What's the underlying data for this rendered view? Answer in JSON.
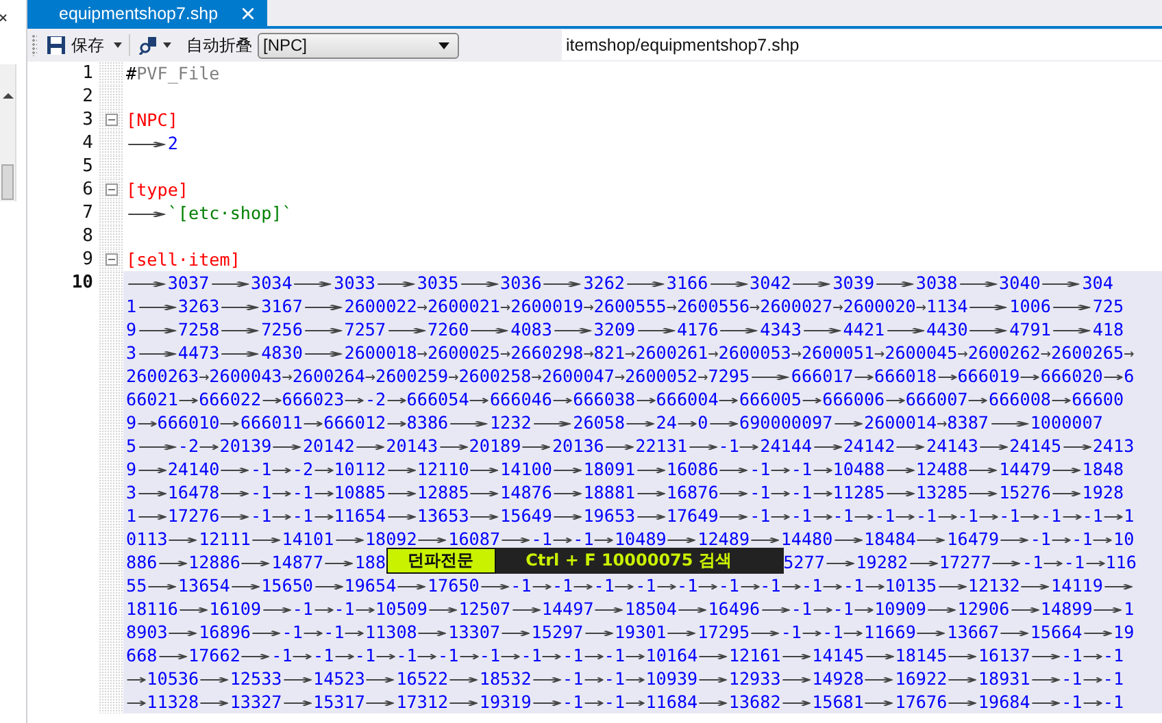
{
  "tab": {
    "title": "equipmentshop7.shp",
    "selected": true
  },
  "toolbar": {
    "save_label": "保存",
    "fold_label": "自动折叠",
    "section_select": "[NPC]",
    "path": "itemshop/equipmentshop7.shp"
  },
  "lines": [
    {
      "number": "1",
      "fold": false,
      "current": false,
      "segments": [
        {
          "kind": "plain",
          "text": "#"
        },
        {
          "kind": "comment",
          "text": "PVF_File"
        }
      ]
    },
    {
      "number": "2",
      "fold": false,
      "current": false
    },
    {
      "number": "3",
      "fold": true,
      "current": false,
      "segments": [
        {
          "kind": "section",
          "text": "[NPC]"
        }
      ]
    },
    {
      "number": "4",
      "fold": false,
      "current": false,
      "segments": [
        {
          "kind": "tab",
          "text": "→"
        },
        {
          "kind": "number",
          "text": "2"
        }
      ]
    },
    {
      "number": "5",
      "fold": false,
      "current": false
    },
    {
      "number": "6",
      "fold": true,
      "current": false,
      "segments": [
        {
          "kind": "section",
          "text": "[type]"
        }
      ]
    },
    {
      "number": "7",
      "fold": false,
      "current": false,
      "segments": [
        {
          "kind": "tab",
          "text": "→"
        },
        {
          "kind": "string",
          "text": "`[etc·shop]`"
        }
      ]
    },
    {
      "number": "8",
      "fold": false,
      "current": false
    },
    {
      "number": "9",
      "fold": true,
      "current": false,
      "segments": [
        {
          "kind": "section",
          "text": "[sell·item]"
        }
      ]
    },
    {
      "number": "10",
      "fold": false,
      "current": true,
      "rows": [
        {
          "text": "→3037→3034→3033→3035→3036→3262→3166→3042→3039→3038→3040→304"
        },
        {
          "text": "1→3263→3167→2600022→2600021→2600019→2600555→2600556→2600027→2600020→1134→1006→725"
        },
        {
          "text": "9→7258→7256→7257→7260→4083→3209→4176→4343→4421→4430→4791→418"
        },
        {
          "text": "3→4473→4830→2600018→2600025→2660298→821→2600261→2600053→2600051→2600045→2600262→2600265→"
        },
        {
          "text": "2600263→2600043→2600264→2600259→2600258→2600047→2600052→7295→666017→666018→666019→666020→6"
        },
        {
          "text": "66021→666022→666023→-2→666054→666046→666038→666004→666005→666006→666007→666008→66600"
        },
        {
          "text": "9→666010→666011→666012→8386→1232→26058→24→0→690000097→2600014→8387→1000007"
        },
        {
          "text": "5→-2→20139→20142→20143→20189→20136→22131→-1→24144→24142→24143→24145→2413"
        },
        {
          "text": "9→24140→-1→-2→10112→12110→14100→18091→16086→-1→-1→10488→12488→14479→1848"
        },
        {
          "text": "3→16478→-1→-1→10885→12885→14876→18881→16876→-1→-1→11285→13285→15276→1928"
        },
        {
          "text": "1→17276→-1→-1→11654→13653→15649→19653→17649→-1→-1→-1→-1→-1→-1→-1→-1→-1→1"
        },
        {
          "text": "0113→12111→14101→18092→16087→-1→-1→10489→12489→14480→18484→16479→-1→-1→10"
        },
        {
          "text": "886→12886→14877→188",
          "covered_by_callout": true,
          "text_after": "5277→19282→17277→-1→-1→116"
        },
        {
          "text": "55→13654→15650→19654→17650→-1→-1→-1→-1→-1→-1→-1→-1→-1→10135→12132→14119→"
        },
        {
          "text": "18116→16109→-1→-1→10509→12507→14497→18504→16496→-1→-1→10909→12906→14899→1"
        },
        {
          "text": "8903→16896→-1→-1→11308→13307→15297→19301→17295→-1→-1→11669→13667→15664→19"
        },
        {
          "text": "668→17662→-1→-1→-1→-1→-1→-1→-1→-1→-1→10164→12161→14145→18145→16137→-1→-1"
        },
        {
          "text": "→10536→12533→14523→16522→18532→-1→-1→10939→12933→14928→16922→18931→-1→-1"
        },
        {
          "text": "→11328→13327→15317→17312→19319→-1→-1→11684→13682→15681→17676→19684→-1→-1"
        }
      ]
    }
  ],
  "callout": {
    "tag": "던파전문",
    "text": "Ctrl + F 10000075 검색"
  }
}
